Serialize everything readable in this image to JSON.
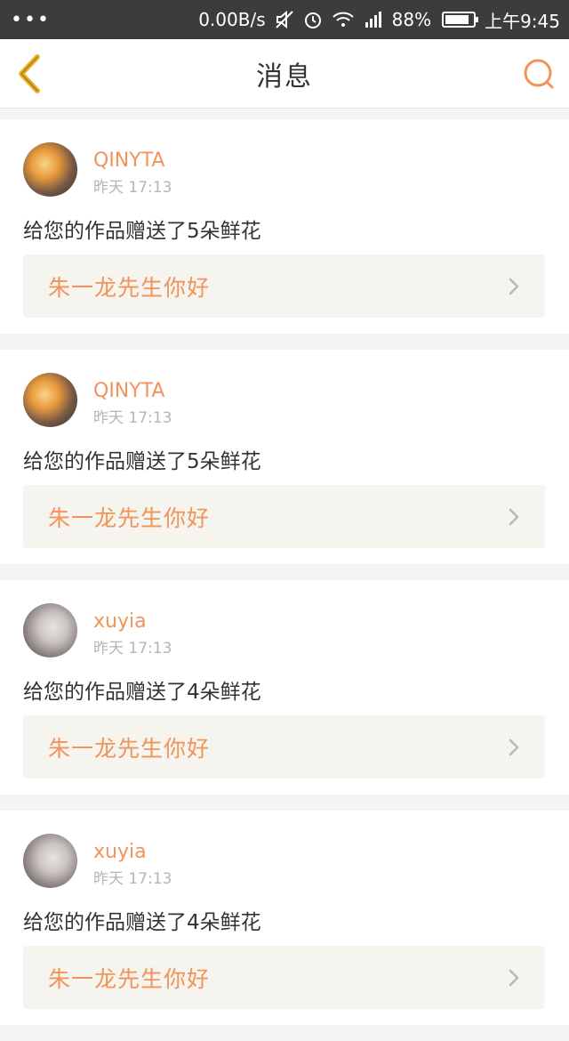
{
  "status_bar": {
    "menu_dots": "•••",
    "net_speed": "0.00B/s",
    "battery": "88%",
    "battery_level": 0.88,
    "time": "上午9:45"
  },
  "header": {
    "title": "消息",
    "back_icon": "chevron-left-icon",
    "search_icon": "search-icon"
  },
  "notifications": [
    {
      "username": "QINYTA",
      "time": "昨天 17:13",
      "message": "给您的作品赠送了5朵鲜花",
      "work_title": "朱一龙先生你好",
      "avatar": "sunset"
    },
    {
      "username": "QINYTA",
      "time": "昨天 17:13",
      "message": "给您的作品赠送了5朵鲜花",
      "work_title": "朱一龙先生你好",
      "avatar": "sunset"
    },
    {
      "username": "xuyia",
      "time": "昨天 17:13",
      "message": "给您的作品赠送了4朵鲜花",
      "work_title": "朱一龙先生你好",
      "avatar": "girl"
    },
    {
      "username": "xuyia",
      "time": "昨天 17:13",
      "message": "给您的作品赠送了4朵鲜花",
      "work_title": "朱一龙先生你好",
      "avatar": "girl"
    }
  ],
  "colors": {
    "accent": "#f29359",
    "back_icon": "#f0b429",
    "status_bar_bg": "#3c3c3c"
  }
}
